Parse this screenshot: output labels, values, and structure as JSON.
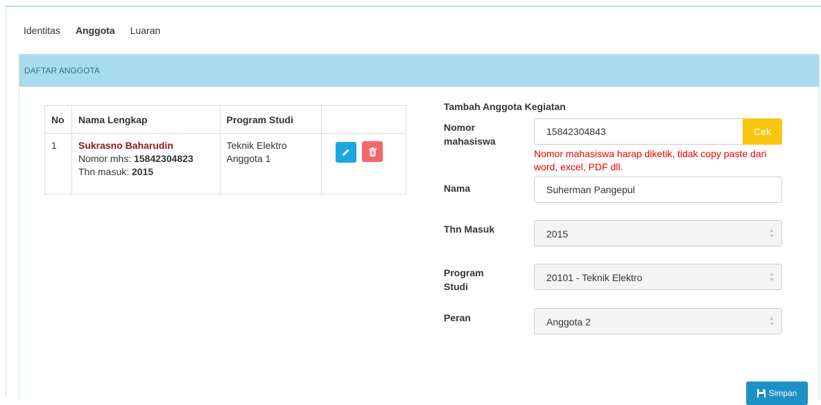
{
  "tabs": [
    {
      "label": "Identitas"
    },
    {
      "label": "Anggota"
    },
    {
      "label": "Luaran"
    }
  ],
  "panel": {
    "heading": "DAFTAR ANGGOTA"
  },
  "table": {
    "headers": [
      "No",
      "Nama Lengkap",
      "Program Studi",
      ""
    ],
    "rows": [
      {
        "no": "1",
        "name": "Sukrasno Baharudin",
        "nim_label": "Nomor mhs: ",
        "nim": "15842304823",
        "year_label": "Thn masuk: ",
        "year": "2015",
        "prodi": "Teknik Elektro",
        "role": "Anggota 1"
      }
    ]
  },
  "form": {
    "title": "Tambah Anggota Kegiatan",
    "nim_label": "Nomor mahasiswa",
    "nim_value": "15842304843",
    "cek_label": "Cek",
    "hint": "Nomor mahasiswa harap diketik, tidak copy paste dari word, excel, PDF dll.",
    "nama_label": "Nama",
    "nama_value": "Suherman Pangepul",
    "thn_label": "Thn Masuk",
    "thn_value": "2015",
    "prodi_label": "Program Studi",
    "prodi_value": "20101 - Teknik Elektro",
    "peran_label": "Peran",
    "peran_value": "Anggota 2",
    "save_label": "Simpan"
  },
  "colors": {
    "panel_heading_bg": "#a8dbec",
    "name_color": "#8b1a1a",
    "edit_btn": "#1ea7de",
    "delete_btn": "#f0696c",
    "cek_btn": "#f9c511",
    "hint_color": "#e60000",
    "save_btn": "#1e90c8"
  },
  "icons": {
    "edit": "pencil-icon",
    "delete": "trash-icon",
    "save": "floppy-disk-icon",
    "select": "select-arrows-icon"
  }
}
